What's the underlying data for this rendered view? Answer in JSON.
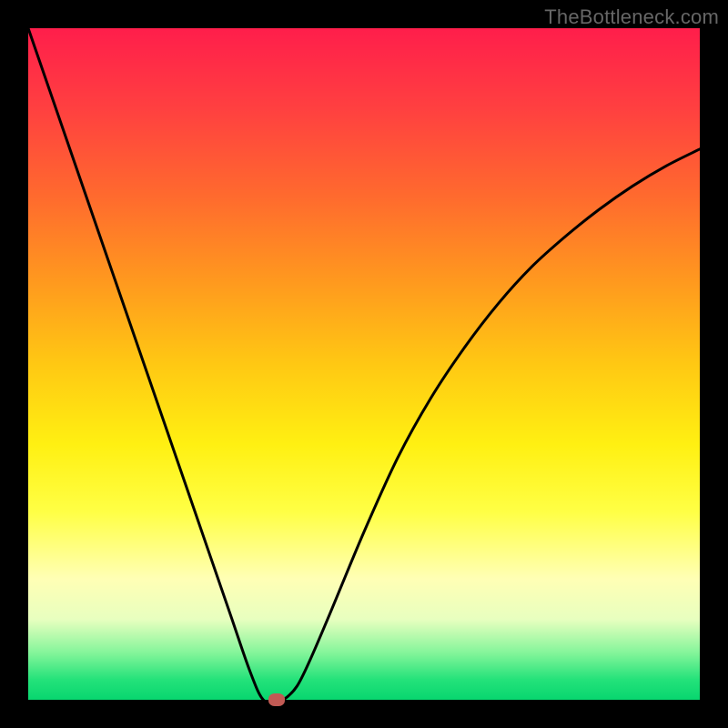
{
  "watermark": "TheBottleneck.com",
  "chart_data": {
    "type": "line",
    "title": "",
    "xlabel": "",
    "ylabel": "",
    "xlim": [
      0,
      100
    ],
    "ylim": [
      0,
      100
    ],
    "series": [
      {
        "name": "curve",
        "x": [
          0,
          5,
          10,
          15,
          20,
          25,
          30,
          33,
          35,
          37,
          38,
          40,
          42,
          45,
          50,
          55,
          60,
          65,
          70,
          75,
          80,
          85,
          90,
          95,
          100
        ],
        "values": [
          100,
          85.5,
          71,
          56.5,
          42,
          27.5,
          13,
          4.3,
          0,
          0,
          0,
          2,
          6,
          13,
          25,
          36,
          45,
          52.5,
          59,
          64.5,
          69,
          73,
          76.5,
          79.5,
          82
        ]
      }
    ],
    "marker": {
      "x": 37,
      "y": 0
    },
    "gradient_stops": [
      {
        "pos": 0,
        "color": "#ff1e4b"
      },
      {
        "pos": 12,
        "color": "#ff4040"
      },
      {
        "pos": 25,
        "color": "#ff6a2e"
      },
      {
        "pos": 38,
        "color": "#ff9a1e"
      },
      {
        "pos": 50,
        "color": "#ffc813"
      },
      {
        "pos": 62,
        "color": "#fff012"
      },
      {
        "pos": 72,
        "color": "#ffff45"
      },
      {
        "pos": 82,
        "color": "#ffffb5"
      },
      {
        "pos": 88,
        "color": "#e8ffbf"
      },
      {
        "pos": 93,
        "color": "#84f59a"
      },
      {
        "pos": 97,
        "color": "#24e27a"
      },
      {
        "pos": 100,
        "color": "#08d66f"
      }
    ]
  }
}
